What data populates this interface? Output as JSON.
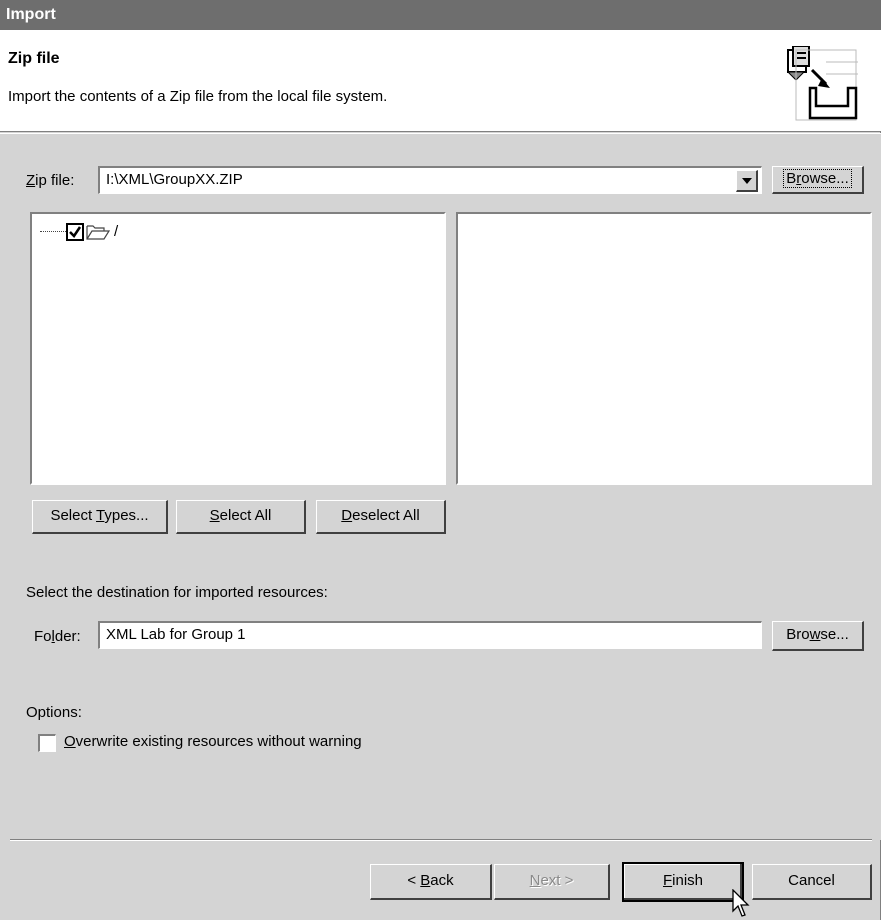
{
  "window": {
    "title": "Import"
  },
  "banner": {
    "title": "Zip file",
    "description": "Import the contents of a Zip file from the local file system."
  },
  "source": {
    "label_prefix": "",
    "label_mn": "Z",
    "label_suffix": "ip file:",
    "value": "I:\\XML\\GroupXX.ZIP",
    "browse_prefix": "B",
    "browse_mn": "r",
    "browse_suffix": "owse..."
  },
  "tree": {
    "root_label": "/",
    "root_checked": true
  },
  "selection_buttons": {
    "select_types": {
      "prefix": "Select ",
      "mn": "T",
      "suffix": "ypes..."
    },
    "select_all": {
      "prefix": "",
      "mn": "S",
      "suffix": "elect All"
    },
    "deselect_all": {
      "prefix": "",
      "mn": "D",
      "suffix": "eselect All"
    }
  },
  "destination": {
    "heading": "Select the destination for imported resources:",
    "label_prefix": "Fo",
    "label_mn": "l",
    "label_suffix": "der:",
    "value": "XML Lab for Group 1",
    "browse_prefix": "Bro",
    "browse_mn": "w",
    "browse_suffix": "se..."
  },
  "options": {
    "heading": "Options:",
    "overwrite": {
      "prefix": "",
      "mn": "O",
      "suffix": "verwrite existing resources without warning",
      "checked": false
    }
  },
  "footer": {
    "back": {
      "prefix": "< ",
      "mn": "B",
      "suffix": "ack"
    },
    "next": {
      "prefix": "",
      "mn": "N",
      "suffix": "ext >",
      "enabled": false
    },
    "finish": {
      "prefix": "",
      "mn": "F",
      "suffix": "inish"
    },
    "cancel": "Cancel"
  }
}
